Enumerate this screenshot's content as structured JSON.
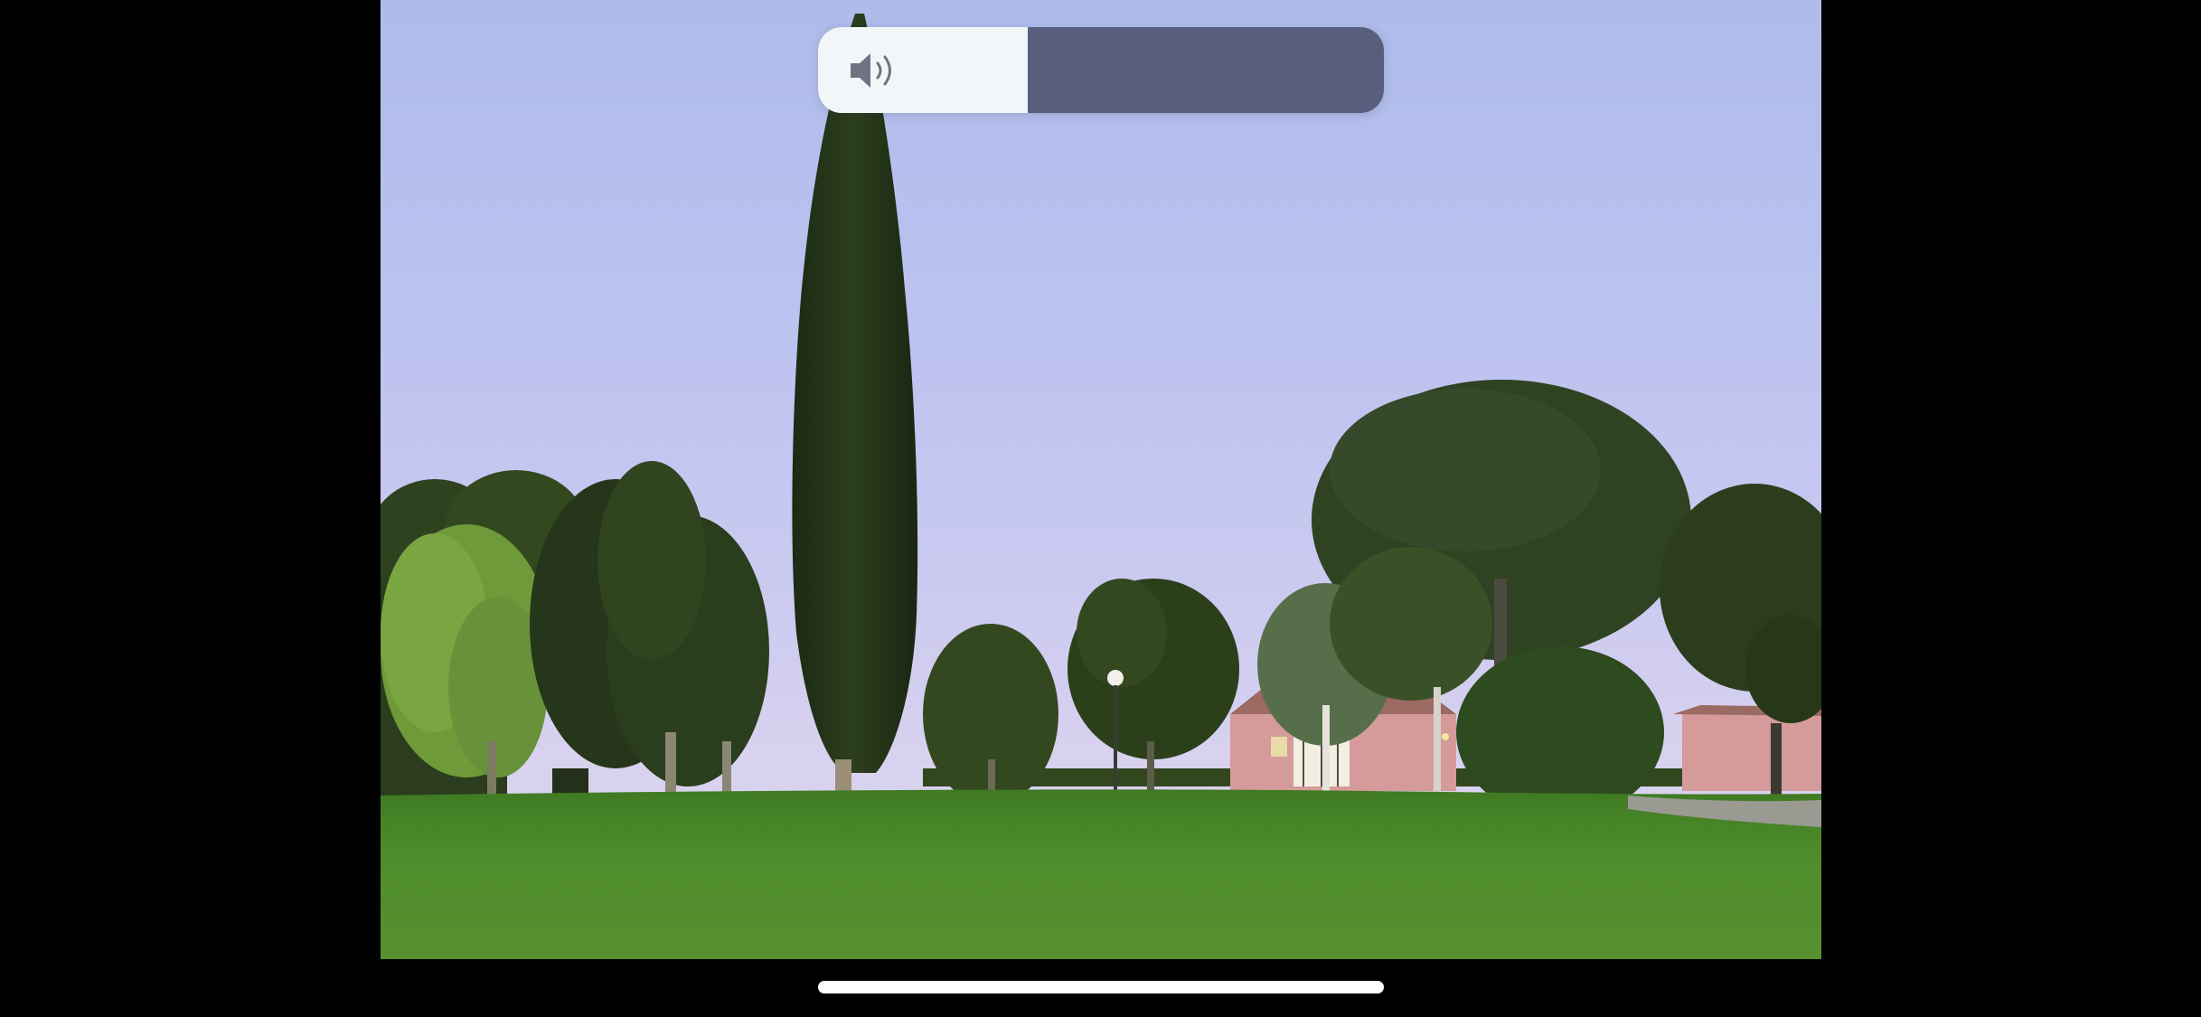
{
  "screen": {
    "background_color": "#000000"
  },
  "photo": {
    "description_icon": "landscape-photo",
    "sky_color": "#bcc3ef",
    "lawn_color": "#4f8a2a"
  },
  "volume_hud": {
    "icon": "speaker-volume-icon",
    "level_percent": 37,
    "track_color": "#575f7d",
    "fill_color": "#f3f6f8",
    "icon_color": "#6e7382"
  },
  "home_indicator": {
    "color": "#ffffff"
  }
}
